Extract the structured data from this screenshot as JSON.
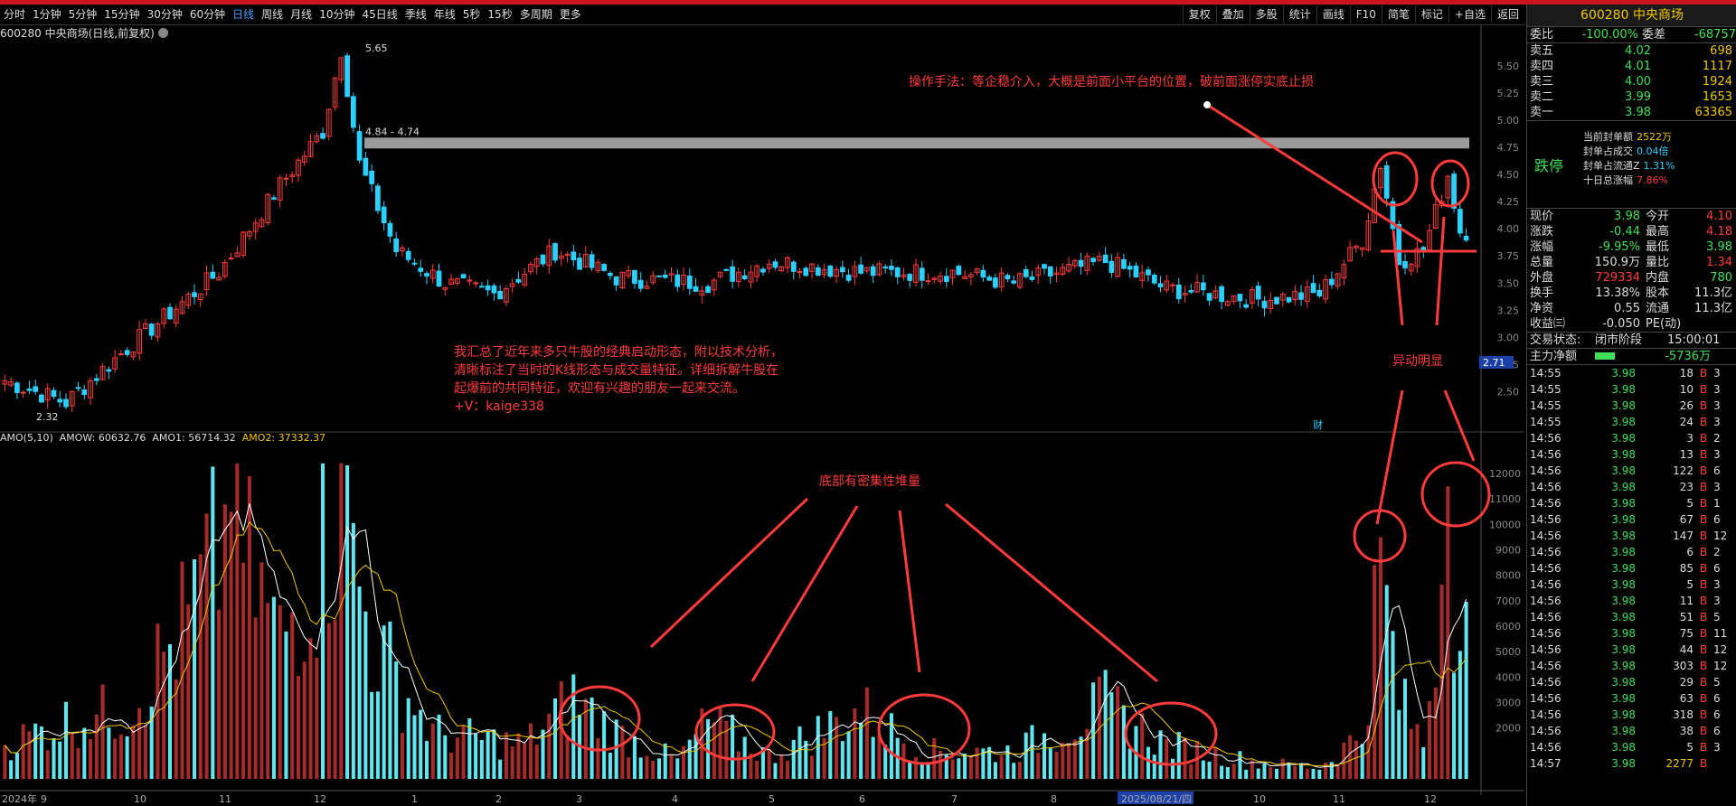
{
  "toolbar": {
    "periods": [
      "分时",
      "1分钟",
      "5分钟",
      "15分钟",
      "30分钟",
      "60分钟",
      "日线",
      "周线",
      "月线",
      "10分钟",
      "45日线",
      "季线",
      "年线",
      "5秒",
      "15秒",
      "多周期",
      "更多"
    ],
    "active": "日线",
    "right": [
      "复权",
      "叠加",
      "多股",
      "统计",
      "画线",
      "F10",
      "简笔",
      "标记",
      "+自选",
      "返回"
    ]
  },
  "chart_header": "600280 中央商场(日线,前复权)",
  "annotations": {
    "method": "操作手法：等企稳介入，大概是前面小平台的位置，破前面涨停实底止损",
    "anomaly": "异动明显",
    "volume_pile": "底部有密集性堆量",
    "note_lines": [
      "我汇总了近年来多只牛股的经典启动形态，附以技术分析，",
      "清晰标注了当时的K线形态与成交量特征。详细拆解牛股在",
      "起爆前的共同特征，欢迎有兴趣的朋友一起来交流。",
      "+V：kaige338"
    ],
    "range_label": "4.84 - 4.74",
    "high_label": "5.65",
    "low_label": "2.32",
    "last_price_tag": "2.71",
    "fin_tag": "财"
  },
  "indicator_bar": {
    "name": "AMO(5,10)",
    "amow": "AMOW: 60632.76",
    "amo1": "AMO1: 56714.32",
    "amo2": "AMO2: 37332.37"
  },
  "chart_data": {
    "type": "candlestick",
    "symbol": "600280",
    "y_ticks": [
      "5.50",
      "5.25",
      "5.00",
      "4.75",
      "4.50",
      "4.25",
      "4.00",
      "3.75",
      "3.50",
      "3.25",
      "3.00",
      "2.75",
      "2.50"
    ],
    "vol_ticks": [
      "12000",
      "11000",
      "10000",
      "9000",
      "8000",
      "7000",
      "6000",
      "5000",
      "4000",
      "3000",
      "2000"
    ],
    "ylim": [
      2.32,
      5.65
    ],
    "x_ticks": [
      "2024年",
      "9",
      "10",
      "11",
      "12",
      "1",
      "2",
      "3",
      "4",
      "5",
      "6",
      "7",
      "8",
      "2025/08/21/四",
      "10",
      "11",
      "12"
    ],
    "resistance_band": [
      4.74,
      4.84
    ],
    "pivots": [
      [
        0,
        2.6
      ],
      [
        10,
        2.4
      ],
      [
        20,
        2.9
      ],
      [
        35,
        3.6
      ],
      [
        45,
        4.4
      ],
      [
        52,
        4.9
      ],
      [
        55,
        5.65
      ],
      [
        58,
        4.6
      ],
      [
        64,
        3.8
      ],
      [
        72,
        3.5
      ],
      [
        80,
        3.4
      ],
      [
        90,
        3.8
      ],
      [
        100,
        3.55
      ],
      [
        115,
        3.5
      ],
      [
        125,
        3.7
      ],
      [
        140,
        3.6
      ],
      [
        155,
        3.6
      ],
      [
        165,
        3.5
      ],
      [
        180,
        3.7
      ],
      [
        190,
        3.45
      ],
      [
        205,
        3.35
      ],
      [
        215,
        3.4
      ],
      [
        222,
        3.9
      ],
      [
        225,
        4.6
      ],
      [
        228,
        3.7
      ],
      [
        232,
        3.8
      ],
      [
        236,
        4.5
      ],
      [
        238,
        3.98
      ]
    ],
    "vol_pivots": [
      [
        0,
        1500
      ],
      [
        10,
        2500
      ],
      [
        20,
        3000
      ],
      [
        30,
        7000
      ],
      [
        37,
        11000
      ],
      [
        45,
        6000
      ],
      [
        55,
        12000
      ],
      [
        60,
        6000
      ],
      [
        70,
        2000
      ],
      [
        85,
        1500
      ],
      [
        93,
        3500
      ],
      [
        100,
        2000
      ],
      [
        110,
        800
      ],
      [
        115,
        2500
      ],
      [
        125,
        1000
      ],
      [
        140,
        3000
      ],
      [
        150,
        1200
      ],
      [
        165,
        1200
      ],
      [
        180,
        3200
      ],
      [
        190,
        1500
      ],
      [
        205,
        700
      ],
      [
        215,
        500
      ],
      [
        222,
        2000
      ],
      [
        225,
        9500
      ],
      [
        228,
        3500
      ],
      [
        232,
        1500
      ],
      [
        236,
        11500
      ],
      [
        238,
        6000
      ]
    ]
  },
  "quote": {
    "code": "600280",
    "name": "中央商场",
    "weibi_label": "委比",
    "weibi": "-100.00%",
    "weicha_label": "委差",
    "weicha": "-68757",
    "asks": [
      [
        "卖五",
        "4.02",
        "698"
      ],
      [
        "卖四",
        "4.01",
        "1117"
      ],
      [
        "卖三",
        "4.00",
        "1924"
      ],
      [
        "卖二",
        "3.99",
        "1653"
      ],
      [
        "卖一",
        "3.98",
        "63365"
      ]
    ],
    "limit_status": "跌停",
    "seal": [
      [
        "当前封单额",
        "2522万"
      ],
      [
        "封单占成交",
        "0.04倍"
      ],
      [
        "封单占流通Z",
        "1.31%"
      ],
      [
        "十日总涨幅",
        "7.86%"
      ]
    ],
    "stats": [
      [
        "现价",
        "3.98",
        "今开",
        "4.10"
      ],
      [
        "涨跌",
        "-0.44",
        "最高",
        "4.18"
      ],
      [
        "涨幅",
        "-9.95%",
        "最低",
        "3.98"
      ],
      [
        "总量",
        "150.9万",
        "量比",
        "1.34"
      ],
      [
        "外盘",
        "729334",
        "内盘",
        "780"
      ],
      [
        "换手",
        "13.38%",
        "股本",
        "11.3亿"
      ],
      [
        "净资",
        "0.55",
        "流通",
        "11.3亿"
      ],
      [
        "收益㈢",
        "-0.050",
        "PE(动)",
        ""
      ]
    ],
    "trade_status_label": "交易状态:",
    "trade_status": "闭市阶段",
    "trade_time": "15:00:01",
    "main_flow_label": "主力净额",
    "main_flow": "-5736万",
    "ticks": [
      [
        "14:55",
        "3.98",
        "18",
        "B",
        "3"
      ],
      [
        "14:55",
        "3.98",
        "10",
        "B",
        "3"
      ],
      [
        "14:55",
        "3.98",
        "26",
        "B",
        "3"
      ],
      [
        "14:55",
        "3.98",
        "24",
        "B",
        "3"
      ],
      [
        "14:56",
        "3.98",
        "3",
        "B",
        "2"
      ],
      [
        "14:56",
        "3.98",
        "13",
        "B",
        "3"
      ],
      [
        "14:56",
        "3.98",
        "122",
        "B",
        "6"
      ],
      [
        "14:56",
        "3.98",
        "23",
        "B",
        "3"
      ],
      [
        "14:56",
        "3.98",
        "5",
        "B",
        "1"
      ],
      [
        "14:56",
        "3.98",
        "67",
        "B",
        "6"
      ],
      [
        "14:56",
        "3.98",
        "147",
        "B",
        "12"
      ],
      [
        "14:56",
        "3.98",
        "6",
        "B",
        "2"
      ],
      [
        "14:56",
        "3.98",
        "85",
        "B",
        "6"
      ],
      [
        "14:56",
        "3.98",
        "5",
        "B",
        "3"
      ],
      [
        "14:56",
        "3.98",
        "11",
        "B",
        "3"
      ],
      [
        "14:56",
        "3.98",
        "51",
        "B",
        "5"
      ],
      [
        "14:56",
        "3.98",
        "75",
        "B",
        "11"
      ],
      [
        "14:56",
        "3.98",
        "44",
        "B",
        "12"
      ],
      [
        "14:56",
        "3.98",
        "303",
        "B",
        "12"
      ],
      [
        "14:56",
        "3.98",
        "29",
        "B",
        "5"
      ],
      [
        "14:56",
        "3.98",
        "63",
        "B",
        "6"
      ],
      [
        "14:56",
        "3.98",
        "318",
        "B",
        "6"
      ],
      [
        "14:56",
        "3.98",
        "38",
        "B",
        "6"
      ],
      [
        "14:56",
        "3.98",
        "5",
        "B",
        "3"
      ],
      [
        "14:57",
        "3.98",
        "2277",
        "B",
        ""
      ]
    ]
  },
  "colors": {
    "up": "#ff3b3b",
    "down": "#2ad0ff",
    "accent": "#c8141e"
  }
}
